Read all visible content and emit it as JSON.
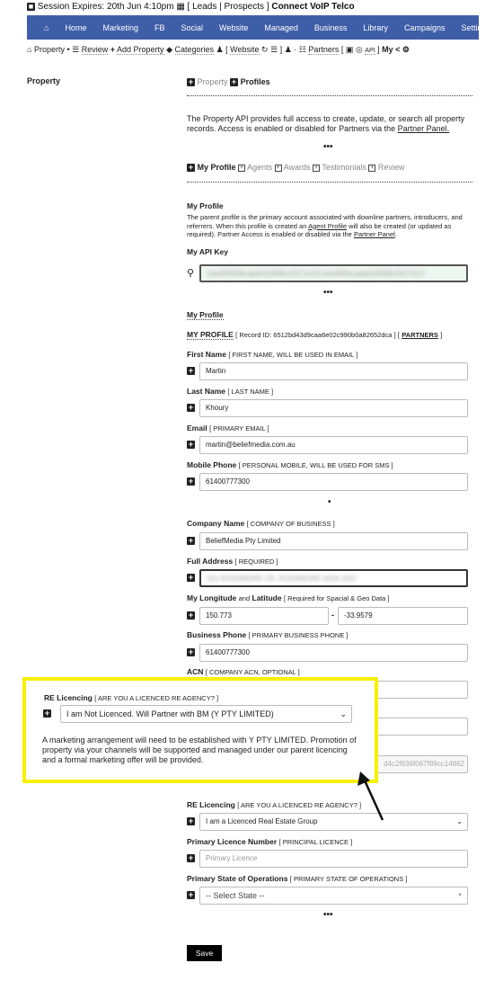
{
  "session": {
    "text": "Session Expires: 20th Jun 4:10pm",
    "leads": "Leads",
    "prospects": "Prospects",
    "connect": "Connect",
    "voip": "VoIP Telco"
  },
  "nav": [
    "Home",
    "Marketing",
    "FB",
    "Social",
    "Website",
    "Managed",
    "Business",
    "Library",
    "Campaigns",
    "Settings"
  ],
  "subnav": {
    "property": "Property",
    "review": "Review",
    "add": "Add Property",
    "categories": "Categories",
    "website": "Website",
    "partners": "Partners",
    "api": "API",
    "my": "My"
  },
  "sidebar": {
    "title": "Property"
  },
  "tabs": {
    "property": "Property",
    "profiles": "Profiles"
  },
  "intro": {
    "text": "The Property API provides full access to create, update, or search all property records. Access is enabled or disabled for Partners via the ",
    "link": "Partner Panel."
  },
  "subtabs": [
    "My Profile",
    "Agents",
    "Awards",
    "Testimonials",
    "Review"
  ],
  "profile": {
    "heading": "My Profile",
    "text1": "The parent profile is the primary account associated with downline partners, introducers, and referrers. When this profile is created an ",
    "link1": "Agent Profile",
    "text2": " will also be created (or updated as required). Partner Access is enabled or disabled via the ",
    "link2": "Partner Panel",
    "text3": ".",
    "api_label": "My API Key",
    "api_value": "1dedf0405bcaba0100f0bc2017e12c1ded0f0bcaba0100f0bc2017e12"
  },
  "section": {
    "heading": "My Profile",
    "title": "MY PROFILE",
    "record": "[ Record ID: 6512bd43d9caa6e02c990b0a82652dca ] [",
    "partners": "PARTNERS",
    "close": "]"
  },
  "fields": {
    "first": {
      "label": "First Name",
      "hint": "[ FIRST NAME, WILL BE USED IN EMAIL ]",
      "value": "Martin"
    },
    "last": {
      "label": "Last Name",
      "hint": "[ LAST NAME ]",
      "value": "Khoury"
    },
    "email": {
      "label": "Email",
      "hint": "[ PRIMARY EMAIL ]",
      "value": "martin@beliefmedia.com.au"
    },
    "mobile": {
      "label": "Mobile Phone",
      "hint": "[ PERSONAL MOBILE, WILL BE USED FOR SMS ]",
      "value": "61400777300"
    },
    "company": {
      "label": "Company Name",
      "hint": "[ COMPANY OF BUSINESS ]",
      "value": "BeliefMedia Pty Limited"
    },
    "address": {
      "label": "Full Address",
      "hint": "[ REQUIRED ]",
      "value": "161 ROSSMORE CR, ROSSMORE NSW 2557"
    },
    "geo": {
      "label1": "My Longitude",
      "and": "and",
      "label2": "Latitude",
      "hint": "[ Required for Spacial & Geo Data ]",
      "lon": "150.773",
      "lat": "-33.9579",
      "sep": "-"
    },
    "bphone": {
      "label": "Business Phone",
      "hint": "[ PRIMARY BUSINESS PHONE ]",
      "value": "61400777300"
    },
    "acn": {
      "label": "ACN",
      "hint": "[ COMPANY ACN, OPTIONAL ]"
    },
    "hash": {
      "value": "d4c2f636f067f89cc14862"
    },
    "licencing": {
      "label": "RE Licencing",
      "hint": "[ ARE YOU A LICENCED RE AGENCY? ]",
      "value": "I am a Licenced Real Estate Group"
    },
    "licence": {
      "label": "Primary Licence Number",
      "hint": "[ PRINCIPAL LICENCE ]",
      "placeholder": "Primary Licence"
    },
    "state": {
      "label": "Primary State of Operations",
      "hint": "[ PRIMARY STATE OF OPERATIONS ]",
      "value": "-- Select State --"
    }
  },
  "save": "Save",
  "callout": {
    "label": "RE Licencing",
    "hint": "[ ARE YOU A LICENCED RE AGENCY? ]",
    "value": "I am Not Licenced. Will Partner with BM (Y PTY LIMITED)",
    "text": "A marketing arrangement will need to be established with Y PTY LIMITED. Promotion of property via your channels will be supported and managed under our parent licencing and a formal marketing offer will be provided.",
    "border_color": "#f7f000"
  },
  "colors": {
    "nav": "#3f5ea8"
  }
}
